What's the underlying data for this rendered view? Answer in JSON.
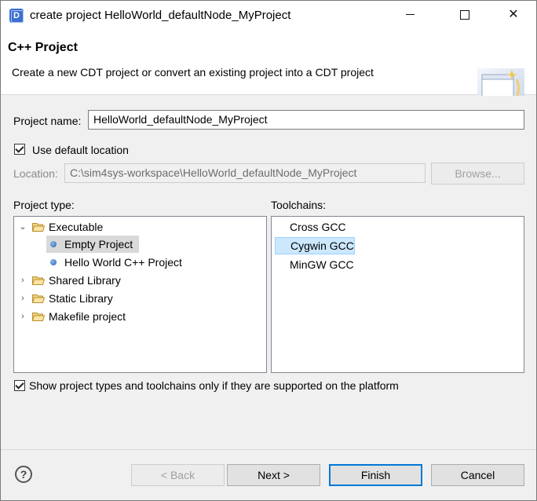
{
  "window": {
    "title": "create project HelloWorld_defaultNode_MyProject",
    "app_icon_letter": "D"
  },
  "header": {
    "title": "C++ Project",
    "description": "Create a new CDT project or convert an existing project into a CDT project"
  },
  "form": {
    "project_name_label": "Project name:",
    "project_name_value": "HelloWorld_defaultNode_MyProject",
    "use_default_location_label": "Use default location",
    "use_default_location_checked": true,
    "location_label": "Location:",
    "location_value": "C:\\sim4sys-workspace\\HelloWorld_defaultNode_MyProject",
    "browse_label": "Browse..."
  },
  "project_type": {
    "label": "Project type:",
    "items": [
      {
        "label": "Executable",
        "kind": "folder",
        "expanded": true
      },
      {
        "label": "Empty Project",
        "kind": "leaf",
        "selected": true
      },
      {
        "label": "Hello World C++ Project",
        "kind": "leaf"
      },
      {
        "label": "Shared Library",
        "kind": "folder",
        "expanded": false
      },
      {
        "label": "Static Library",
        "kind": "folder",
        "expanded": false
      },
      {
        "label": "Makefile project",
        "kind": "folder",
        "expanded": false
      }
    ]
  },
  "toolchains": {
    "label": "Toolchains:",
    "items": [
      "Cross GCC",
      "Cygwin GCC",
      "MinGW GCC"
    ],
    "selected": "Cygwin GCC"
  },
  "filter": {
    "label": "Show project types and toolchains only if they are supported on the platform",
    "checked": true
  },
  "buttons": {
    "back": "< Back",
    "next": "Next >",
    "finish": "Finish",
    "cancel": "Cancel"
  },
  "icons": {
    "help": "help-icon",
    "expand": "chevron-down-icon",
    "collapsed": "chevron-right-icon",
    "folder": "folder-open-icon"
  },
  "colors": {
    "selection": "#cce8ff",
    "default_button_border": "#0078d7"
  }
}
